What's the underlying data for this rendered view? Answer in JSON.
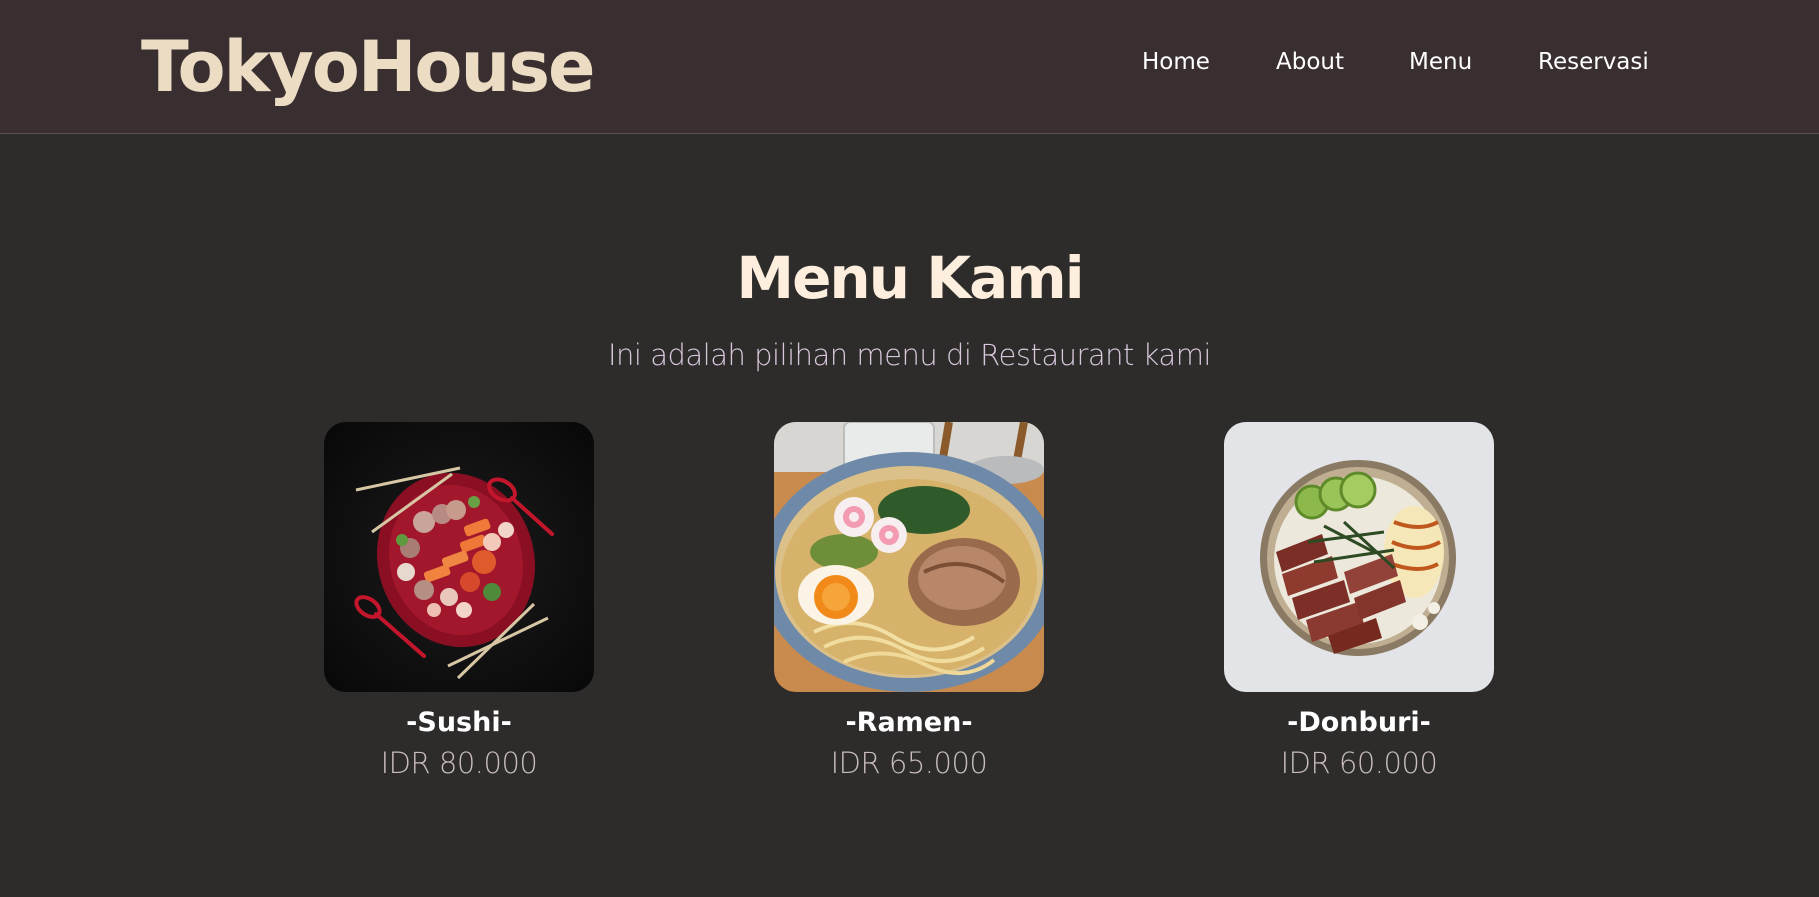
{
  "brand": {
    "name": "TokyoHouse"
  },
  "nav": {
    "items": [
      {
        "label": "Home"
      },
      {
        "label": "About"
      },
      {
        "label": "Menu"
      },
      {
        "label": "Reservasi"
      }
    ]
  },
  "menu_section": {
    "title": "Menu Kami",
    "subtitle": "Ini adalah pilihan menu di Restaurant kami",
    "items": [
      {
        "name": "-Sushi-",
        "price": "IDR 80.000",
        "photo": "sushi-platter-photo"
      },
      {
        "name": "-Ramen-",
        "price": "IDR 65.000",
        "photo": "ramen-bowl-photo"
      },
      {
        "name": "-Donburi-",
        "price": "IDR 60.000",
        "photo": "donburi-bowl-photo"
      }
    ]
  },
  "colors": {
    "navbar_bg": "#3a2f30",
    "page_bg": "#2e2b2b",
    "brand": "#ecdcc4",
    "title": "#fdeedd"
  }
}
